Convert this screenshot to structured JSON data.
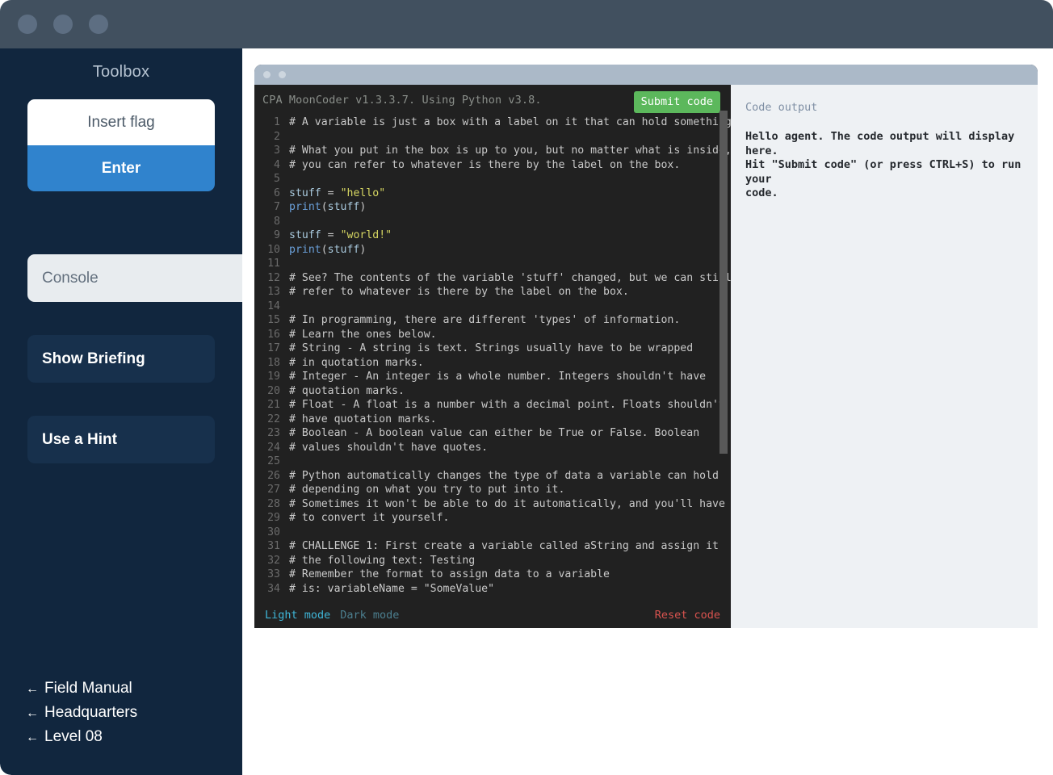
{
  "window": {
    "titlebar_dots": [
      "dot-1",
      "dot-2",
      "dot-3"
    ]
  },
  "sidebar": {
    "title": "Toolbox",
    "flag_input_placeholder": "Insert flag",
    "flag_input_value": "",
    "enter_label": "Enter",
    "nav_items": [
      {
        "label": "Console",
        "active": true
      },
      {
        "label": "Show Briefing",
        "active": false
      },
      {
        "label": "Use a Hint",
        "active": false
      }
    ],
    "links": [
      {
        "arrow": "←",
        "label": "Field Manual"
      },
      {
        "arrow": "←",
        "label": "Headquarters"
      },
      {
        "arrow": "←",
        "label": "Level 08"
      }
    ]
  },
  "editor": {
    "version_line": "CPA MoonCoder v1.3.3.7. Using Python v3.8.",
    "submit_label": "Submit code",
    "footer": {
      "light_mode": "Light mode",
      "dark_mode": "Dark mode",
      "reset_code": "Reset code"
    },
    "code_lines": [
      {
        "n": "1",
        "segments": [
          {
            "t": "# A variable is just a box with a label on it that can hold something.",
            "c": "cm"
          }
        ]
      },
      {
        "n": "2",
        "segments": [
          {
            "t": "",
            "c": "cm"
          }
        ]
      },
      {
        "n": "3",
        "segments": [
          {
            "t": "# What you put in the box is up to you, but no matter what is inside,",
            "c": "cm"
          }
        ]
      },
      {
        "n": "4",
        "segments": [
          {
            "t": "# you can refer to whatever is there by the label on the box.",
            "c": "cm"
          }
        ]
      },
      {
        "n": "5",
        "segments": [
          {
            "t": "",
            "c": "cm"
          }
        ]
      },
      {
        "n": "6",
        "segments": [
          {
            "t": "stuff",
            "c": "kw-var"
          },
          {
            "t": " ",
            "c": "ct"
          },
          {
            "t": "=",
            "c": "kw-op"
          },
          {
            "t": " ",
            "c": "ct"
          },
          {
            "t": "\"hello\"",
            "c": "kw-str"
          }
        ]
      },
      {
        "n": "7",
        "segments": [
          {
            "t": "print",
            "c": "kw-fn"
          },
          {
            "t": "(",
            "c": "kw-pn"
          },
          {
            "t": "stuff",
            "c": "kw-var"
          },
          {
            "t": ")",
            "c": "kw-pn"
          }
        ]
      },
      {
        "n": "8",
        "segments": [
          {
            "t": "",
            "c": "cm"
          }
        ]
      },
      {
        "n": "9",
        "segments": [
          {
            "t": "stuff",
            "c": "kw-var"
          },
          {
            "t": " ",
            "c": "ct"
          },
          {
            "t": "=",
            "c": "kw-op"
          },
          {
            "t": " ",
            "c": "ct"
          },
          {
            "t": "\"world!\"",
            "c": "kw-str"
          }
        ]
      },
      {
        "n": "10",
        "segments": [
          {
            "t": "print",
            "c": "kw-fn"
          },
          {
            "t": "(",
            "c": "kw-pn"
          },
          {
            "t": "stuff",
            "c": "kw-var"
          },
          {
            "t": ")",
            "c": "kw-pn"
          }
        ]
      },
      {
        "n": "11",
        "segments": [
          {
            "t": "",
            "c": "cm"
          }
        ]
      },
      {
        "n": "12",
        "segments": [
          {
            "t": "# See? The contents of the variable 'stuff' changed, but we can still",
            "c": "cm"
          }
        ]
      },
      {
        "n": "13",
        "segments": [
          {
            "t": "# refer to whatever is there by the label on the box.",
            "c": "cm"
          }
        ]
      },
      {
        "n": "14",
        "segments": [
          {
            "t": "",
            "c": "cm"
          }
        ]
      },
      {
        "n": "15",
        "segments": [
          {
            "t": "# In programming, there are different 'types' of information.",
            "c": "cm"
          }
        ]
      },
      {
        "n": "16",
        "segments": [
          {
            "t": "# Learn the ones below.",
            "c": "cm"
          }
        ]
      },
      {
        "n": "17",
        "segments": [
          {
            "t": "# String - A string is text. Strings usually have to be wrapped",
            "c": "cm"
          }
        ]
      },
      {
        "n": "18",
        "segments": [
          {
            "t": "# in quotation marks.",
            "c": "cm"
          }
        ]
      },
      {
        "n": "19",
        "segments": [
          {
            "t": "# Integer - An integer is a whole number. Integers shouldn't have",
            "c": "cm"
          }
        ]
      },
      {
        "n": "20",
        "segments": [
          {
            "t": "# quotation marks.",
            "c": "cm"
          }
        ]
      },
      {
        "n": "21",
        "segments": [
          {
            "t": "# Float - A float is a number with a decimal point. Floats shouldn't",
            "c": "cm"
          }
        ]
      },
      {
        "n": "22",
        "segments": [
          {
            "t": "# have quotation marks.",
            "c": "cm"
          }
        ]
      },
      {
        "n": "23",
        "segments": [
          {
            "t": "# Boolean - A boolean value can either be True or False. Boolean",
            "c": "cm"
          }
        ]
      },
      {
        "n": "24",
        "segments": [
          {
            "t": "# values shouldn't have quotes.",
            "c": "cm"
          }
        ]
      },
      {
        "n": "25",
        "segments": [
          {
            "t": "",
            "c": "cm"
          }
        ]
      },
      {
        "n": "26",
        "segments": [
          {
            "t": "# Python automatically changes the type of data a variable can hold",
            "c": "cm"
          }
        ]
      },
      {
        "n": "27",
        "segments": [
          {
            "t": "# depending on what you try to put into it.",
            "c": "cm"
          }
        ]
      },
      {
        "n": "28",
        "segments": [
          {
            "t": "# Sometimes it won't be able to do it automatically, and you'll have",
            "c": "cm"
          }
        ]
      },
      {
        "n": "29",
        "segments": [
          {
            "t": "# to convert it yourself.",
            "c": "cm"
          }
        ]
      },
      {
        "n": "30",
        "segments": [
          {
            "t": "",
            "c": "cm"
          }
        ]
      },
      {
        "n": "31",
        "segments": [
          {
            "t": "# CHALLENGE 1: First create a variable called aString and assign it",
            "c": "cm"
          }
        ]
      },
      {
        "n": "32",
        "segments": [
          {
            "t": "# the following text: Testing",
            "c": "cm"
          }
        ]
      },
      {
        "n": "33",
        "segments": [
          {
            "t": "# Remember the format to assign data to a variable",
            "c": "cm"
          }
        ]
      },
      {
        "n": "34",
        "segments": [
          {
            "t": "# is: variableName = \"SomeValue\"",
            "c": "cm"
          }
        ]
      }
    ]
  },
  "output": {
    "label": "Code output",
    "text": "Hello agent. The code output will display here.\nHit \"Submit code\" (or press CTRL+S) to run your\ncode."
  },
  "colors": {
    "accent_blue": "#3083cd",
    "sidebar_bg": "#11263e",
    "titlebar_bg": "#41505f",
    "submit_green": "#5cb85c",
    "reset_red": "#d9534f",
    "light_mode_cyan": "#3fb6d8",
    "string_yellow": "#d6d662",
    "function_blue": "#6a9fd8"
  }
}
